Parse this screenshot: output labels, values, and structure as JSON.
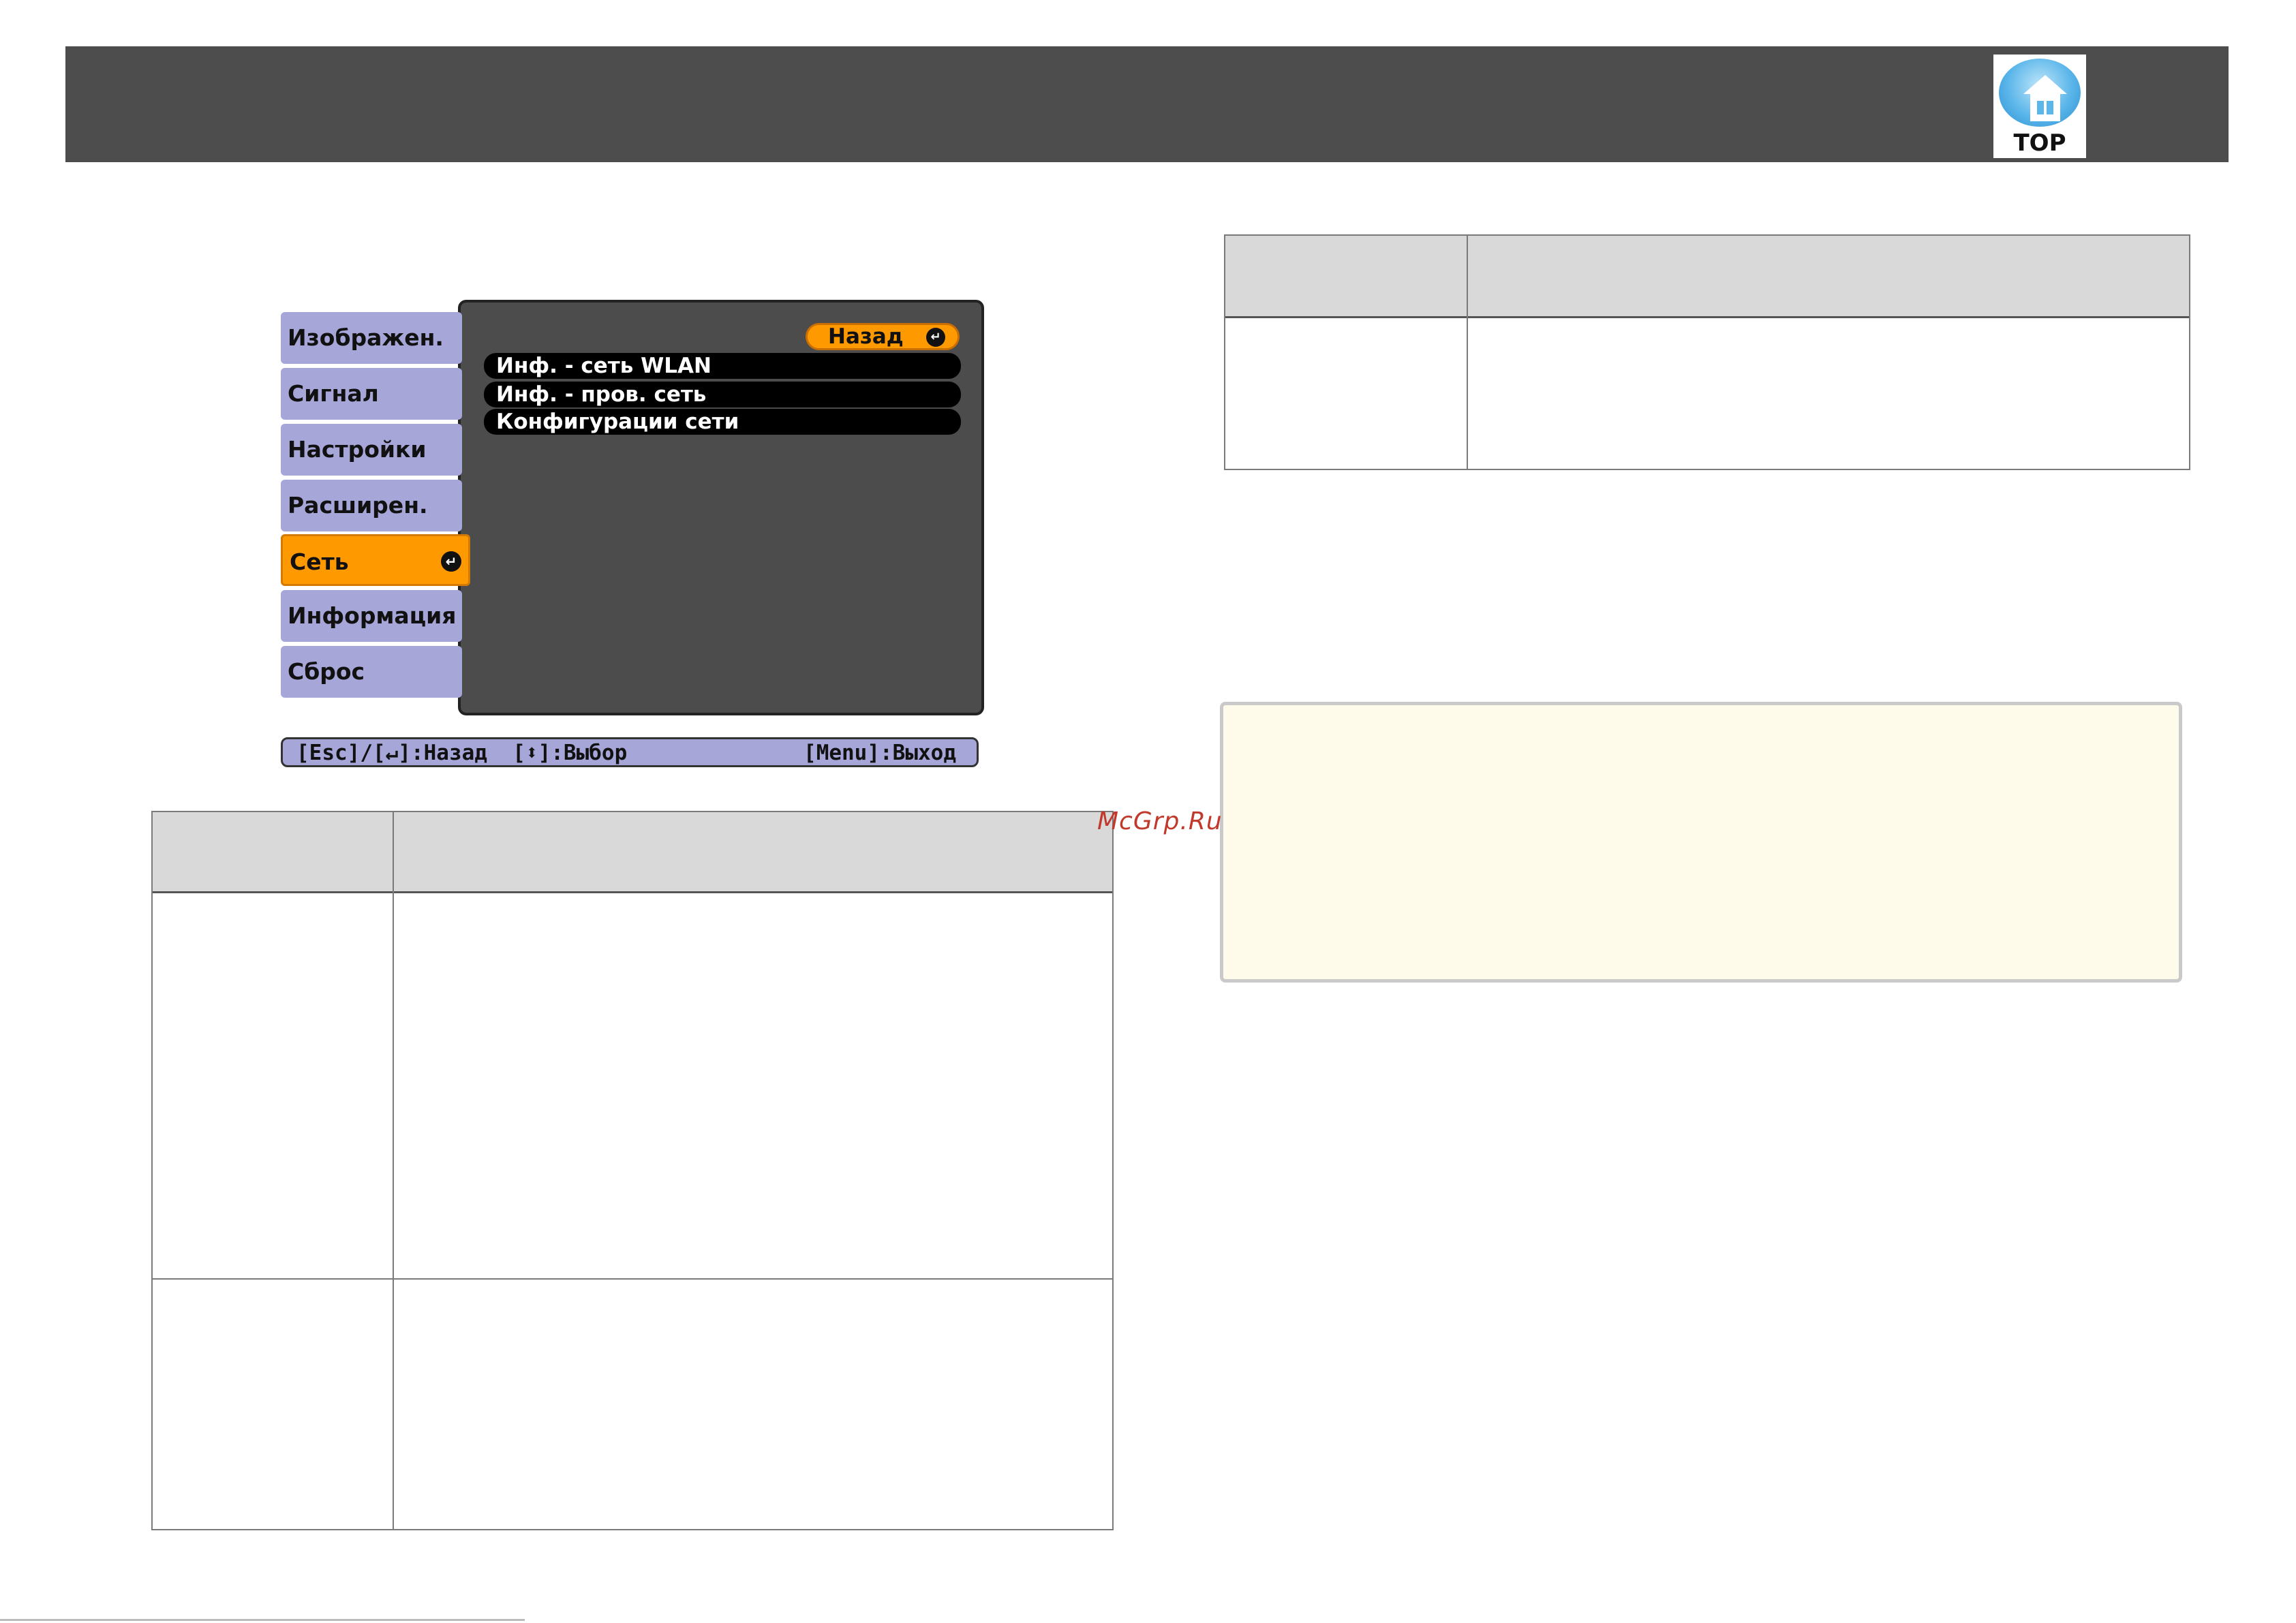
{
  "header": {
    "top_button_label": "TOP",
    "top_icon": "home-icon"
  },
  "menu": {
    "tabs": [
      {
        "label": "Изображен."
      },
      {
        "label": "Сигнал"
      },
      {
        "label": "Настройки"
      },
      {
        "label": "Расширен."
      },
      {
        "label": "Сеть",
        "active": true
      },
      {
        "label": "Информация"
      },
      {
        "label": "Сброс"
      }
    ],
    "back_label": "Назад",
    "items": [
      "Инф. - сеть WLAN",
      "Инф. - пров. сеть",
      "Конфигурации сети"
    ],
    "enter_glyph": "↵",
    "status_left": "[Esc]/[↵]:Назад  [⬍]:Выбор",
    "status_right": "[Menu]:Выход",
    "accent_color": "#ff9900",
    "tab_color": "#a6a6d9"
  },
  "watermark": "McGrp.Ru"
}
